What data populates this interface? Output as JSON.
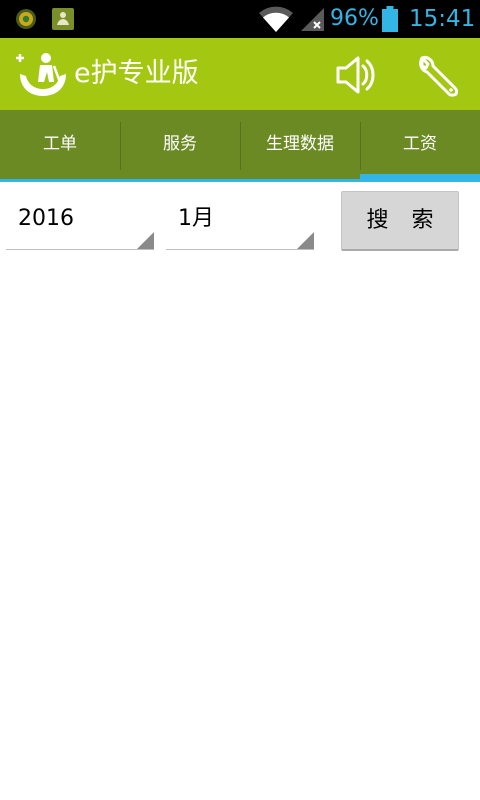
{
  "status_bar": {
    "notification_icons": [
      "app-notification-icon",
      "gallery-notification-icon"
    ],
    "wifi_icon": "wifi-icon",
    "signal_icon": "signal-icon",
    "battery_percent": "96%",
    "battery_icon": "battery-icon",
    "time": "15:41",
    "accent_color": "#33b5e5"
  },
  "app_bar": {
    "title": "e护专业版",
    "logo_icon": "caregiver-hands-logo-icon",
    "speaker_icon": "speaker-icon",
    "settings_icon": "wrench-icon",
    "background_color": "#a4c811"
  },
  "tabs": {
    "items": [
      {
        "label": "工单",
        "selected": false
      },
      {
        "label": "服务",
        "selected": false
      },
      {
        "label": "生理数据",
        "selected": false
      },
      {
        "label": "工资",
        "selected": true
      }
    ],
    "background_color": "#6b8a23",
    "indicator_color": "#33b5e5"
  },
  "filter": {
    "year": "2016",
    "month": "1月",
    "search_label": "搜 索"
  }
}
